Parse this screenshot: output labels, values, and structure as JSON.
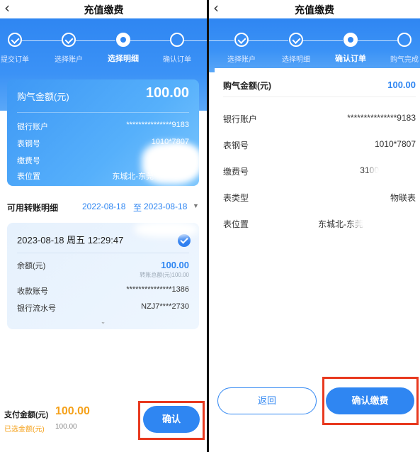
{
  "colors": {
    "brand_blue": "#2f86f2",
    "accent_orange": "#f5a11a",
    "highlight_red": "#e8391f"
  },
  "left": {
    "title": "充值缴费",
    "back_icon": "chevron-left-icon",
    "steps": [
      {
        "label": "提交订单",
        "state": "done"
      },
      {
        "label": "选择账户",
        "state": "done"
      },
      {
        "label": "选择明细",
        "state": "current"
      },
      {
        "label": "确认订单",
        "state": "pending"
      }
    ],
    "amount_card": {
      "amount_label": "购气金额(元)",
      "amount_value": "100.00",
      "bank_account_label": "银行账户",
      "bank_account_value": "***************9183",
      "meter_no_label": "表钢号",
      "meter_no_value": "1010*7807",
      "payment_no_label": "缴费号",
      "location_label": "表位置",
      "location_value": "东城北-东莞"
    },
    "transfer": {
      "title": "可用转账明细",
      "date_from": "2022-08-18",
      "to_text": "至",
      "date_to": "2023-08-18",
      "caret_icon": "caret-down-icon"
    },
    "transaction": {
      "datetime": "2023-08-18 周五 12:29:47",
      "balance_label": "余额(元)",
      "balance_value": "100.00",
      "transfer_total": "转账总额(元)100.00",
      "receiver_label": "收款账号",
      "receiver_value": "***************1386",
      "serial_label": "银行流水号",
      "serial_value": "NZJ7****2730",
      "expand_icon": "chevron-down-icon"
    },
    "footer": {
      "pay_label": "支付金额(元)",
      "pay_value": "100.00",
      "selected_label": "已选金额(元)",
      "selected_value": "100.00",
      "confirm_label": "确认"
    }
  },
  "right": {
    "title": "充值缴费",
    "back_icon": "chevron-left-icon",
    "steps": [
      {
        "label": "选择账户",
        "state": "done"
      },
      {
        "label": "选择明细",
        "state": "done"
      },
      {
        "label": "确认订单",
        "state": "current"
      },
      {
        "label": "购气完成",
        "state": "pending"
      }
    ],
    "details": [
      {
        "label": "购气金额(元)",
        "value": "100.00"
      },
      {
        "label": "银行账户",
        "value": "***************9183"
      },
      {
        "label": "表钢号",
        "value": "1010*7807"
      },
      {
        "label": "缴费号",
        "value": "3100"
      },
      {
        "label": "表类型",
        "value": "物联表"
      },
      {
        "label": "表位置",
        "value": "东城北-东莞"
      }
    ],
    "back_label": "返回",
    "pay_label": "确认缴费"
  }
}
